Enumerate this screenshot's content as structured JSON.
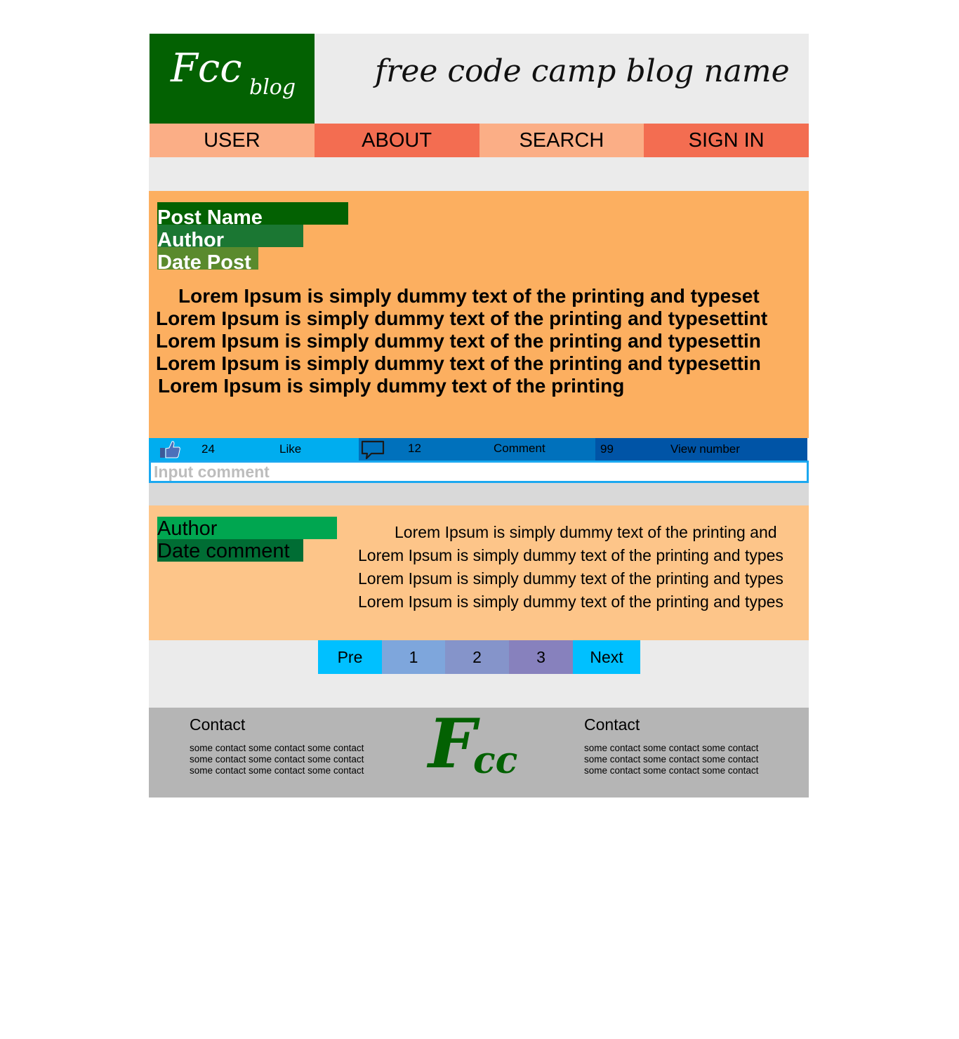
{
  "header": {
    "logo_main": "Fcc",
    "logo_sub": "blog",
    "blog_title": "free code camp blog name"
  },
  "nav": {
    "items": [
      {
        "label": "USER"
      },
      {
        "label": "ABOUT"
      },
      {
        "label": "SEARCH"
      },
      {
        "label": "SIGN IN"
      }
    ]
  },
  "post": {
    "name": "Post Name",
    "author": "Author",
    "date": "Date Post",
    "body_lines": [
      "Lorem Ipsum is simply dummy text of the printing and typeset",
      "Lorem Ipsum is simply dummy text of the printing and typesettint",
      "Lorem Ipsum is simply dummy text of the printing and typesettin",
      "Lorem Ipsum is simply dummy text of the printing and typesettin",
      "Lorem Ipsum is simply dummy text of the printing"
    ]
  },
  "stats": {
    "likes_count": "24",
    "likes_label": "Like",
    "comments_count": "12",
    "comments_label": "Comment",
    "views_count": "99",
    "views_label": "View number",
    "like_icon": "thumbs-up-icon",
    "comment_icon": "speech-bubble-icon"
  },
  "comment_input": {
    "placeholder": "Input comment",
    "value": ""
  },
  "comment": {
    "author": "Author",
    "date": "Date comment",
    "body_lines": [
      "Lorem Ipsum is simply dummy text of the printing and",
      "Lorem Ipsum is simply dummy text of the printing and types",
      "Lorem Ipsum is simply dummy text of the printing and types",
      "Lorem Ipsum is simply dummy text of the printing and types"
    ]
  },
  "pagination": {
    "prev": "Pre",
    "pages": [
      "1",
      "2",
      "3"
    ],
    "next": "Next"
  },
  "footer": {
    "left_title": "Contact",
    "left_lines": [
      "some contact some contact some contact",
      "some contact some contact some contact",
      "some contact some contact some contact"
    ],
    "logo_big": "F",
    "logo_small": "cc",
    "right_title": "Contact",
    "right_lines": [
      "some contact some contact some contact",
      "some contact some contact some contact",
      "some contact some contact some contact"
    ]
  },
  "colors": {
    "brand_green": "#036102",
    "nav_light": "#fbae86",
    "nav_dark": "#f36d51",
    "post_bg": "#fcaf60",
    "comment_bg": "#fdc589",
    "like_bar": "#00adef",
    "comment_bar": "#0071bc",
    "view_bar": "#0054a6",
    "footer_bg": "#b5b5b5"
  }
}
